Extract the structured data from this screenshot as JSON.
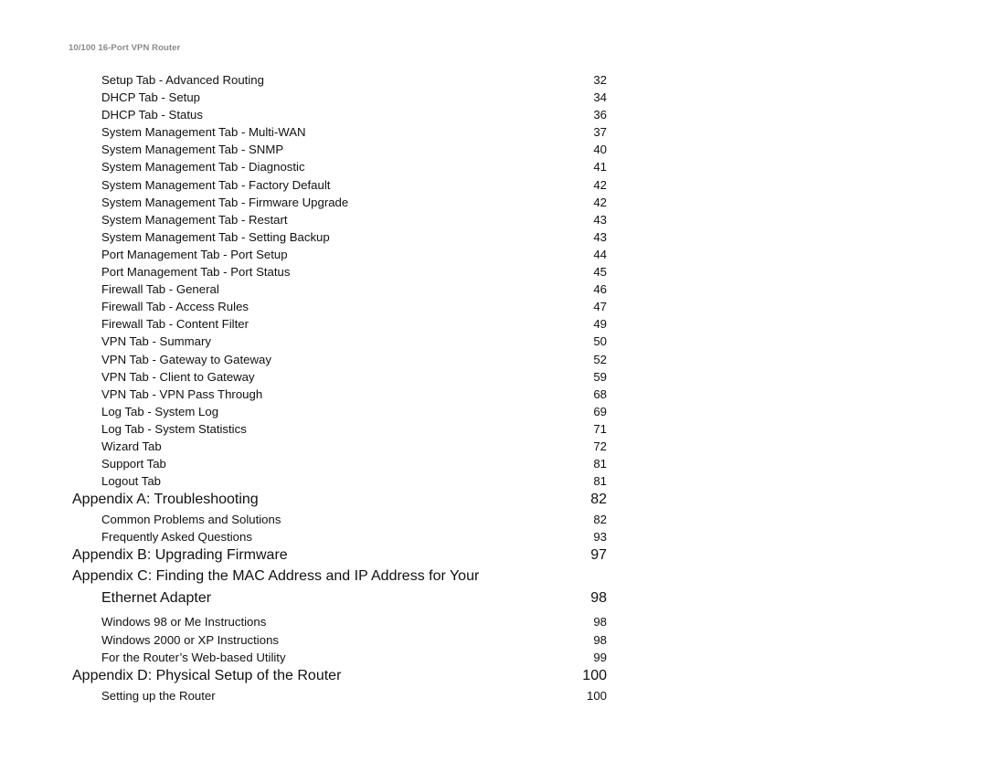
{
  "header": {
    "title": "10/100 16-Port VPN Router"
  },
  "toc": [
    {
      "type": "sub",
      "label": "Setup Tab - Advanced Routing",
      "page": "32"
    },
    {
      "type": "sub",
      "label": "DHCP Tab - Setup",
      "page": "34"
    },
    {
      "type": "sub",
      "label": "DHCP Tab - Status",
      "page": "36"
    },
    {
      "type": "sub",
      "label": "System Management Tab - Multi-WAN",
      "page": "37"
    },
    {
      "type": "sub",
      "label": "System Management Tab - SNMP",
      "page": "40"
    },
    {
      "type": "sub",
      "label": "System Management Tab - Diagnostic",
      "page": "41"
    },
    {
      "type": "sub",
      "label": "System Management Tab - Factory Default",
      "page": "42"
    },
    {
      "type": "sub",
      "label": "System Management Tab - Firmware Upgrade",
      "page": "42"
    },
    {
      "type": "sub",
      "label": "System Management Tab - Restart",
      "page": "43"
    },
    {
      "type": "sub",
      "label": "System Management Tab - Setting Backup",
      "page": "43"
    },
    {
      "type": "sub",
      "label": "Port Management Tab - Port Setup",
      "page": "44"
    },
    {
      "type": "sub",
      "label": "Port Management Tab - Port Status",
      "page": "45"
    },
    {
      "type": "sub",
      "label": "Firewall Tab - General",
      "page": "46"
    },
    {
      "type": "sub",
      "label": "Firewall Tab - Access Rules",
      "page": "47"
    },
    {
      "type": "sub",
      "label": "Firewall Tab - Content Filter",
      "page": "49"
    },
    {
      "type": "sub",
      "label": "VPN Tab - Summary",
      "page": "50"
    },
    {
      "type": "sub",
      "label": "VPN Tab - Gateway to Gateway",
      "page": "52"
    },
    {
      "type": "sub",
      "label": "VPN Tab - Client to Gateway",
      "page": "59"
    },
    {
      "type": "sub",
      "label": "VPN Tab - VPN Pass Through",
      "page": "68"
    },
    {
      "type": "sub",
      "label": "Log Tab - System Log",
      "page": "69"
    },
    {
      "type": "sub",
      "label": "Log Tab - System Statistics",
      "page": "71"
    },
    {
      "type": "sub",
      "label": "Wizard Tab",
      "page": "72"
    },
    {
      "type": "sub",
      "label": "Support Tab",
      "page": "81"
    },
    {
      "type": "sub",
      "label": "Logout Tab",
      "page": "81"
    },
    {
      "type": "main",
      "label": "Appendix A: Troubleshooting",
      "page": "82"
    },
    {
      "type": "sub",
      "label": "Common Problems and Solutions",
      "page": "82"
    },
    {
      "type": "sub",
      "label": "Frequently Asked Questions",
      "page": "93"
    },
    {
      "type": "main",
      "label": "Appendix B: Upgrading Firmware",
      "page": "97"
    },
    {
      "type": "nonum",
      "label": "Appendix C: Finding the MAC Address and IP Address for Your",
      "page": ""
    },
    {
      "type": "cont",
      "label": "Ethernet Adapter",
      "page": "98"
    },
    {
      "type": "sub",
      "label": "Windows 98 or Me Instructions",
      "page": "98"
    },
    {
      "type": "sub",
      "label": "Windows 2000 or XP Instructions",
      "page": "98"
    },
    {
      "type": "sub",
      "label": "For the Router’s Web-based Utility",
      "page": "99"
    },
    {
      "type": "main",
      "label": "Appendix D: Physical Setup of the Router",
      "page": "100"
    },
    {
      "type": "sub",
      "label": "Setting up the Router",
      "page": "100"
    }
  ]
}
